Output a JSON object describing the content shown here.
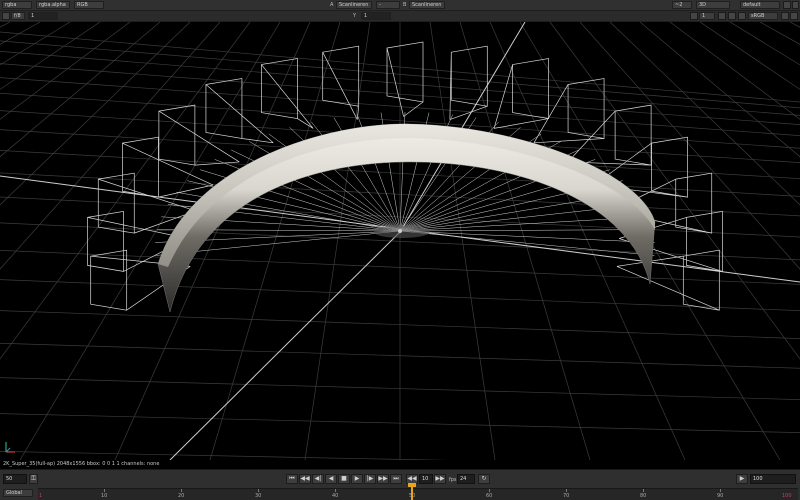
{
  "toolbar1": {
    "channels": "rgba",
    "alpha_channel": "rgba.alpha",
    "display": "RGB",
    "a_label": "A",
    "a_input": "Scanlineren",
    "blend": "-",
    "b_label": "B",
    "b_input": "Scanlineren",
    "proxy": "~2",
    "view_mode": "3D",
    "lut_profile": "default"
  },
  "toolbar2": {
    "fstop": "f/8",
    "gain_value": "1",
    "y_label": "Y",
    "y_value": "1",
    "zoom": "1",
    "colorspace": "sRGB"
  },
  "info": {
    "text": "2K_Super_35(full-ap) 2048x1556  bbox: 0 0 1 1  channels: none"
  },
  "transport": {
    "frame": "50",
    "global_label": "Global",
    "step": "10",
    "fps_label": "fps",
    "fps": "24",
    "end_frame": "100",
    "timeline_ticks": [
      "10",
      "20",
      "30",
      "40",
      "50",
      "60",
      "70",
      "80",
      "90"
    ],
    "start_marker": "1",
    "end_marker": "100",
    "playhead_frame": 50
  },
  "icons": [
    "lock-icon",
    "play-icon",
    "stop-icon",
    "rewind-icon",
    "fast-forward-icon",
    "loop-icon",
    "axis-gizmo-icon"
  ],
  "colors": {
    "background": "#000000",
    "wire": "#ffffff",
    "toolbar": "#303030",
    "accent": "#e8a51a"
  }
}
